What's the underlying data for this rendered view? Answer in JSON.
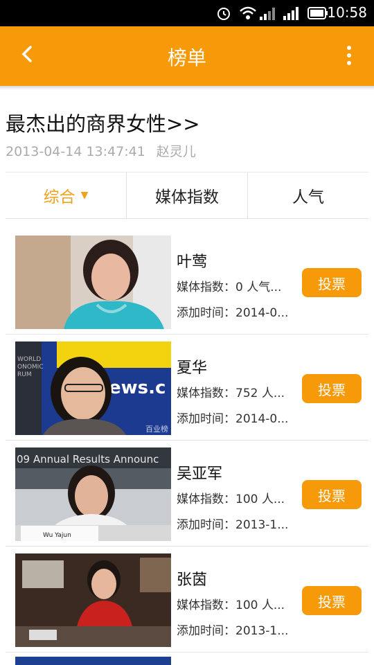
{
  "status": {
    "time": "10:58"
  },
  "appbar": {
    "title": "榜单"
  },
  "article": {
    "title": "最杰出的商界女性>>",
    "date": "2013-04-14 13:47:41",
    "author": "赵灵儿"
  },
  "tabs": [
    {
      "label": "综合",
      "caret": "▼"
    },
    {
      "label": "媒体指数"
    },
    {
      "label": "人气"
    }
  ],
  "items": [
    {
      "name": "叶莺",
      "media": "媒体指数：0 人气...",
      "added": "添加时间：2014-0...",
      "vote": "投票"
    },
    {
      "name": "夏华",
      "media": "媒体指数：752 人...",
      "added": "添加时间：2014-0...",
      "vote": "投票"
    },
    {
      "name": "吴亚军",
      "media": "媒体指数：100 人...",
      "added": "添加时间：2013-1...",
      "vote": "投票"
    },
    {
      "name": "张茵",
      "media": "媒体指数：100 人...",
      "added": "添加时间：2013-1...",
      "vote": "投票"
    }
  ],
  "photos": {
    "p2": {
      "overlay": "ews.c",
      "wm": "百业榜",
      "side": "WORLD\nONOMIC\nRUM"
    },
    "p3": {
      "banner": "09 Annual Results Announc",
      "badge": "Wu Yajun"
    }
  },
  "colors": {
    "accent": "#f79a09",
    "tab_active": "#f0a11e"
  }
}
